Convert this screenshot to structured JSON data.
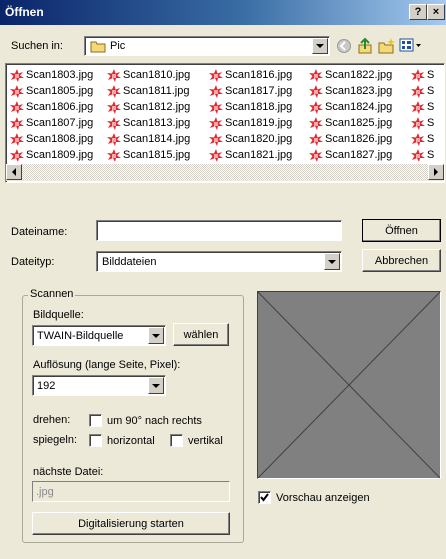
{
  "window": {
    "title": "Öffnen",
    "help_label": "?",
    "close_label": "×"
  },
  "toolbar": {
    "look_in_label": "Suchen in:",
    "look_in_value": "Pic"
  },
  "files": {
    "columns": [
      [
        "Scan1803.jpg",
        "Scan1805.jpg",
        "Scan1806.jpg",
        "Scan1807.jpg",
        "Scan1808.jpg",
        "Scan1809.jpg"
      ],
      [
        "Scan1810.jpg",
        "Scan1811.jpg",
        "Scan1812.jpg",
        "Scan1813.jpg",
        "Scan1814.jpg",
        "Scan1815.jpg"
      ],
      [
        "Scan1816.jpg",
        "Scan1817.jpg",
        "Scan1818.jpg",
        "Scan1819.jpg",
        "Scan1820.jpg",
        "Scan1821.jpg"
      ],
      [
        "Scan1822.jpg",
        "Scan1823.jpg",
        "Scan1824.jpg",
        "Scan1825.jpg",
        "Scan1826.jpg",
        "Scan1827.jpg"
      ],
      [
        "S",
        "S",
        "S",
        "S",
        "S",
        "S"
      ]
    ]
  },
  "form": {
    "filename_label": "Dateiname:",
    "filename_value": "",
    "filetype_label": "Dateityp:",
    "filetype_value": "Bilddateien",
    "open_label": "Öffnen",
    "cancel_label": "Abbrechen"
  },
  "scan": {
    "legend": "Scannen",
    "source_label": "Bildquelle:",
    "source_value": "TWAIN-Bildquelle",
    "choose_label": "wählen",
    "resolution_label": "Auflösung (lange Seite, Pixel):",
    "resolution_value": "192",
    "rotate_label": "drehen:",
    "rotate_option": "um 90° nach rechts",
    "mirror_label": "spiegeln:",
    "mirror_horizontal": "horizontal",
    "mirror_vertical": "vertikal",
    "next_file_label": "nächste Datei:",
    "next_file_value": ".jpg",
    "start_label": "Digitalisierung starten"
  },
  "preview": {
    "show_label": "Vorschau anzeigen",
    "show_checked": true
  },
  "colors": {
    "title_start": "#0a246a",
    "title_end": "#a6caf0",
    "face": "#ece9d8",
    "icon_red": "#e8242c"
  }
}
